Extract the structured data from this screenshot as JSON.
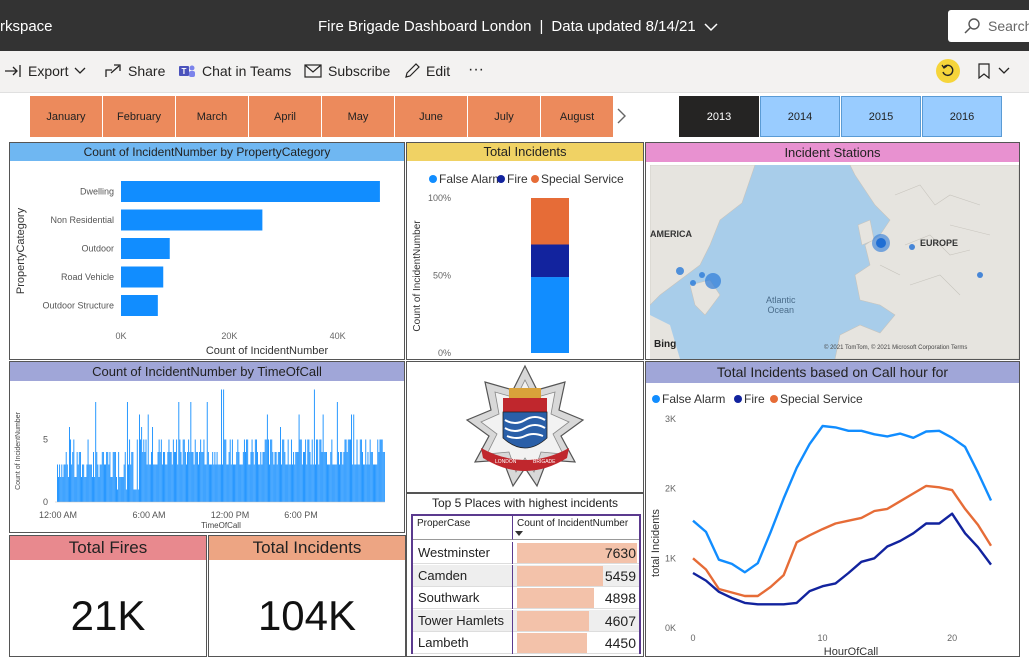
{
  "topbar": {
    "workspace": "rkspace",
    "title": "Fire Brigade Dashboard London",
    "updated": "Data updated 8/14/21",
    "search_placeholder": "Search"
  },
  "toolbar": {
    "export": "Export",
    "share": "Share",
    "teams": "Chat in Teams",
    "subscribe": "Subscribe",
    "edit": "Edit",
    "more": "···"
  },
  "months": [
    "January",
    "February",
    "March",
    "April",
    "May",
    "June",
    "July",
    "August"
  ],
  "years": [
    "2013",
    "2014",
    "2015",
    "2016"
  ],
  "selected_year": "2013",
  "colors": {
    "false_alarm": "#118dff",
    "fire": "#12239e",
    "special": "#e66c37",
    "bar": "#118dff",
    "month_slicer": "#ec8a5c",
    "year_slicer": "#99ccff",
    "year_selected": "#252423"
  },
  "property_panel": {
    "title": "Count of IncidentNumber by PropertyCategory"
  },
  "total_incidents_panel": {
    "title": "Total Incidents"
  },
  "stations_panel": {
    "title": "Incident Stations",
    "america": "AMERICA",
    "europe": "EUROPE",
    "ocean": "Atlantic\nOcean",
    "bing": "Bing",
    "copyright": "© 2021 TomTom, © 2021 Microsoft Corporation Terms"
  },
  "timeofcall_panel": {
    "title": "Count of IncidentNumber by TimeOfCall"
  },
  "callhour_panel": {
    "title": "Total Incidents based on Call hour for"
  },
  "top5": {
    "title": "Top 5 Places with highest incidents",
    "col1": "ProperCase",
    "col2": "Count of IncidentNumber",
    "rows": [
      {
        "place": "Westminster",
        "count": "7630",
        "value": 7630
      },
      {
        "place": "Camden",
        "count": "5459",
        "value": 5459
      },
      {
        "place": "Southwark",
        "count": "4898",
        "value": 4898
      },
      {
        "place": "Tower Hamlets",
        "count": "4607",
        "value": 4607
      },
      {
        "place": "Lambeth",
        "count": "4450",
        "value": 4450
      }
    ]
  },
  "kpis": {
    "fires_label": "Total Fires",
    "fires_value": "21K",
    "incidents_label": "Total Incidents",
    "incidents_value": "104K"
  },
  "chart_data": [
    {
      "type": "bar",
      "title": "Count of IncidentNumber by PropertyCategory",
      "orientation": "horizontal",
      "categories": [
        "Dwelling",
        "Non Residential",
        "Outdoor",
        "Road Vehicle",
        "Outdoor Structure"
      ],
      "values": [
        47800,
        26100,
        9000,
        7800,
        6800
      ],
      "xlabel": "Count of IncidentNumber",
      "ylabel": "PropertyCategory",
      "xticks": [
        "0K",
        "20K",
        "40K"
      ],
      "xlim": [
        0,
        48000
      ]
    },
    {
      "type": "bar",
      "title": "Total Incidents",
      "stacked": true,
      "percent": true,
      "series": [
        {
          "name": "False Alarm",
          "values": [
            49
          ]
        },
        {
          "name": "Fire",
          "values": [
            21
          ]
        },
        {
          "name": "Special Service",
          "values": [
            30
          ]
        }
      ],
      "ylabel": "Count of IncidentNumber",
      "yticks": [
        "0%",
        "50%",
        "100%"
      ]
    },
    {
      "type": "bar",
      "title": "Count of IncidentNumber by TimeOfCall",
      "xlabel": "TimeOfCall",
      "ylabel": "Count of IncidentNumber",
      "xticks": [
        "12:00 AM",
        "6:00 AM",
        "12:00 PM",
        "6:00 PM"
      ],
      "yticks": [
        "0",
        "5"
      ],
      "ylim": [
        0,
        8
      ]
    },
    {
      "type": "line",
      "title": "Total Incidents based on Call hour for",
      "xlabel": "HourOfCall",
      "ylabel": "total Incidents",
      "xticks": [
        "0",
        "10",
        "20"
      ],
      "yticks": [
        "0K",
        "1K",
        "2K",
        "3K"
      ],
      "ylim": [
        0,
        3000
      ],
      "x": [
        0,
        1,
        2,
        3,
        4,
        5,
        6,
        7,
        8,
        9,
        10,
        11,
        12,
        13,
        14,
        15,
        16,
        17,
        18,
        19,
        20,
        21,
        22,
        23
      ],
      "series": [
        {
          "name": "False Alarm",
          "values": [
            1540,
            1380,
            980,
            920,
            800,
            930,
            1380,
            1860,
            2300,
            2640,
            2900,
            2880,
            2830,
            2830,
            2780,
            2750,
            2790,
            2730,
            2820,
            2830,
            2730,
            2600,
            2230,
            1830
          ]
        },
        {
          "name": "Fire",
          "values": [
            790,
            680,
            520,
            430,
            360,
            340,
            340,
            340,
            360,
            530,
            600,
            640,
            790,
            950,
            1000,
            1170,
            1250,
            1360,
            1500,
            1500,
            1640,
            1360,
            1160,
            910
          ]
        },
        {
          "name": "Special Service",
          "values": [
            1000,
            840,
            560,
            510,
            460,
            460,
            590,
            760,
            1230,
            1330,
            1420,
            1500,
            1540,
            1580,
            1680,
            1710,
            1820,
            1930,
            2040,
            2020,
            1980,
            1710,
            1480,
            1180
          ]
        }
      ]
    }
  ]
}
